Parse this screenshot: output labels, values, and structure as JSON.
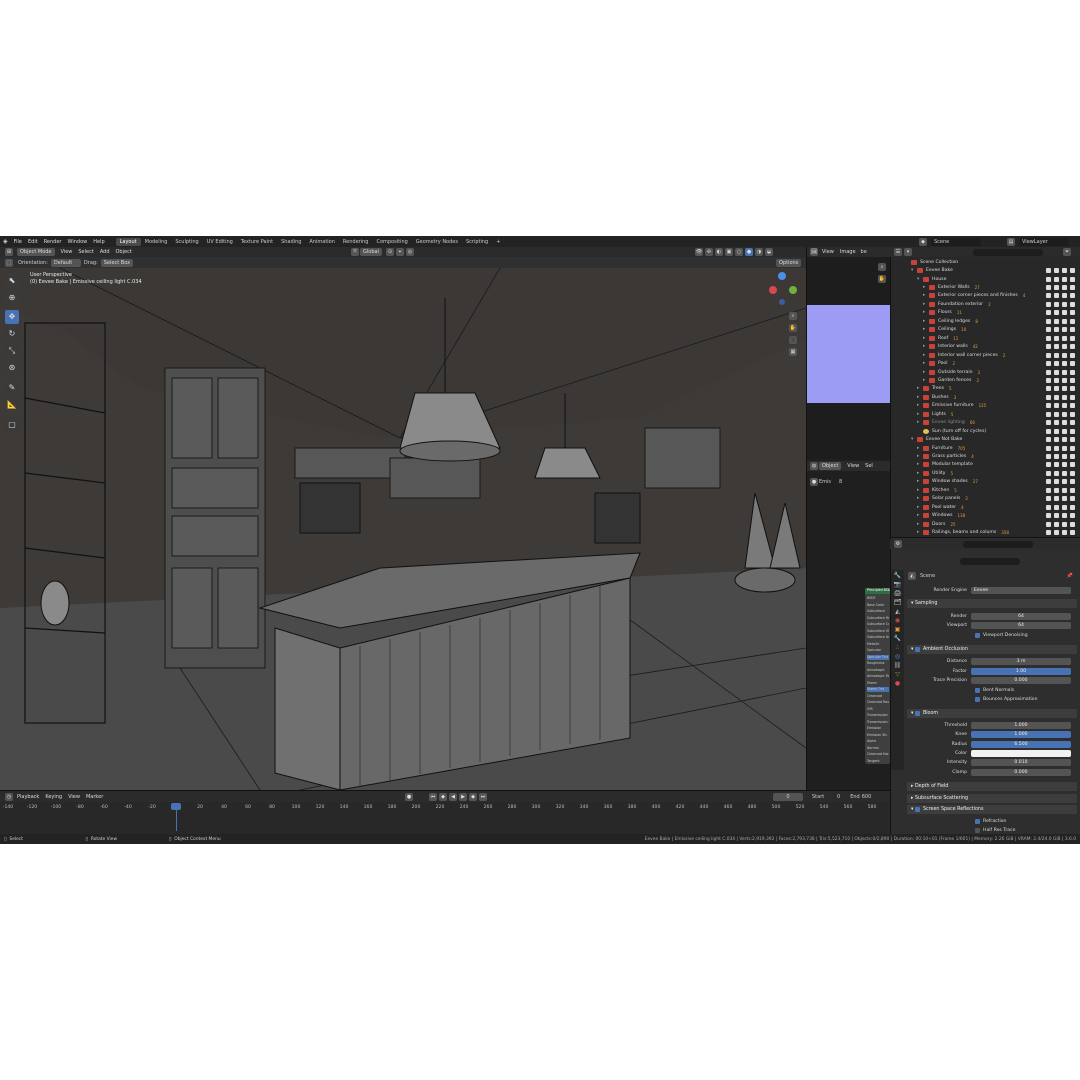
{
  "topbar": {
    "menus": [
      "File",
      "Edit",
      "Render",
      "Window",
      "Help"
    ],
    "workspaces": [
      "Layout",
      "Modeling",
      "Sculpting",
      "UV Editing",
      "Texture Paint",
      "Shading",
      "Animation",
      "Rendering",
      "Compositing",
      "Geometry Nodes",
      "Scripting",
      "+"
    ],
    "active_workspace": "Layout",
    "scene": "Scene",
    "view_layer": "ViewLayer"
  },
  "viewport_header": {
    "mode": "Object Mode",
    "menus": [
      "View",
      "Select",
      "Add",
      "Object"
    ],
    "transform": "Global",
    "orientation_label": "Orientation:",
    "orientation_value": "Default",
    "drag_label": "Drag:",
    "drag_value": "Select Box",
    "options": "Options"
  },
  "viewport": {
    "perspective": "User Perspective",
    "context": "(0) Eevee Bake | Emissive ceiling light C.034"
  },
  "image_editor": {
    "menus": [
      "View",
      "Image"
    ],
    "tab": "be"
  },
  "node_editor": {
    "mode": "Object",
    "menu": "View",
    "menu2": "Sel",
    "tab": "Emis",
    "count": "8",
    "node_title": "Principled BSDF",
    "node_rows": [
      "BSDF",
      "Base Color",
      "Subsurface",
      "Subsurface Rad.",
      "Subsurface Col.",
      "Subsurface IOR",
      "Subsurface Aniso",
      "Metallic",
      "Specular",
      "Specular Tint",
      "Roughness",
      "Anisotropic",
      "Anisotropic Rot.",
      "Sheen",
      "Sheen Tint",
      "Clearcoat",
      "Clearcoat Rough.",
      "IOR",
      "Transmission",
      "Transmission R.",
      "Emission",
      "Emission Str.",
      "Alpha",
      "Normal",
      "Clearcoat Normal",
      "Tangent"
    ]
  },
  "outliner": {
    "rows": [
      {
        "label": "Scene Collection",
        "indent": 0,
        "arrow": ""
      },
      {
        "label": "Eevee Bake",
        "indent": 1,
        "arrow": "▾"
      },
      {
        "label": "House",
        "indent": 2,
        "arrow": "▾"
      },
      {
        "label": "Exterior Walls",
        "indent": 3,
        "arrow": "▸",
        "badge": "27"
      },
      {
        "label": "Exterior corner pieces and finishes",
        "indent": 3,
        "arrow": "▸",
        "badge": "4"
      },
      {
        "label": "Foundation exterior",
        "indent": 3,
        "arrow": "▸",
        "badge": "2"
      },
      {
        "label": "Floors",
        "indent": 3,
        "arrow": "▸",
        "badge": "11"
      },
      {
        "label": "Ceiling ledges",
        "indent": 3,
        "arrow": "▸",
        "badge": "8"
      },
      {
        "label": "Ceilings",
        "indent": 3,
        "arrow": "▸",
        "badge": "10"
      },
      {
        "label": "Roof",
        "indent": 3,
        "arrow": "▸",
        "badge": "11"
      },
      {
        "label": "Interior walls",
        "indent": 3,
        "arrow": "▸",
        "badge": "42"
      },
      {
        "label": "Interior wall corner pieces",
        "indent": 3,
        "arrow": "▸",
        "badge": "2"
      },
      {
        "label": "Pool",
        "indent": 3,
        "arrow": "▸",
        "badge": "2"
      },
      {
        "label": "Outside terrain",
        "indent": 3,
        "arrow": "▸",
        "badge": "3"
      },
      {
        "label": "Garden fences",
        "indent": 3,
        "arrow": "▸",
        "badge": "3"
      },
      {
        "label": "Trees",
        "indent": 2,
        "arrow": "▸",
        "badge": "5"
      },
      {
        "label": "Bushes",
        "indent": 2,
        "arrow": "▸",
        "badge": "3"
      },
      {
        "label": "Emissive furniture",
        "indent": 2,
        "arrow": "▸",
        "badge": "125"
      },
      {
        "label": "Lights",
        "indent": 2,
        "arrow": "▸",
        "badge": "5"
      },
      {
        "label": "Eevee lighting",
        "indent": 2,
        "arrow": "▸",
        "badge": "66",
        "dim": true
      },
      {
        "label": "Sun (turn off for cycles)",
        "indent": 2,
        "arrow": "",
        "light": true
      },
      {
        "label": "Eevee Not Bake",
        "indent": 1,
        "arrow": "▾"
      },
      {
        "label": "Furniture",
        "indent": 2,
        "arrow": "▸",
        "badge": "705"
      },
      {
        "label": "Grass particles",
        "indent": 2,
        "arrow": "▸",
        "badge": "4"
      },
      {
        "label": "Modular template",
        "indent": 2,
        "arrow": "▸"
      },
      {
        "label": "Utility",
        "indent": 2,
        "arrow": "▸",
        "badge": "5"
      },
      {
        "label": "Window shades",
        "indent": 2,
        "arrow": "▸",
        "badge": "27"
      },
      {
        "label": "Kitchen",
        "indent": 2,
        "arrow": "▸",
        "badge": "5"
      },
      {
        "label": "Solar panels",
        "indent": 2,
        "arrow": "▸",
        "badge": "2"
      },
      {
        "label": "Pool water",
        "indent": 2,
        "arrow": "▸",
        "badge": "4"
      },
      {
        "label": "Windows",
        "indent": 2,
        "arrow": "▸",
        "badge": "138"
      },
      {
        "label": "Doors",
        "indent": 2,
        "arrow": "▸",
        "badge": "25"
      },
      {
        "label": "Railings, beams and colums",
        "indent": 2,
        "arrow": "▸",
        "badge": "358"
      }
    ]
  },
  "properties": {
    "scene_label": "Scene",
    "render_engine_label": "Render Engine",
    "render_engine": "Eevee",
    "sampling": {
      "title": "Sampling",
      "render_label": "Render",
      "render": "64",
      "viewport_label": "Viewport",
      "viewport": "64",
      "denoise": "Viewport Denoising"
    },
    "ao": {
      "title": "Ambient Occlusion",
      "distance_label": "Distance",
      "distance": "3 m",
      "factor_label": "Factor",
      "factor": "1.00",
      "precision_label": "Trace Precision",
      "precision": "0.000",
      "bent": "Bent Normals",
      "bounces": "Bounces Approximation"
    },
    "bloom": {
      "title": "Bloom",
      "threshold_label": "Threshold",
      "threshold": "1.000",
      "knee_label": "Knee",
      "knee": "1.000",
      "radius_label": "Radius",
      "radius": "6.500",
      "color_label": "Color",
      "intensity_label": "Intensity",
      "intensity": "0.010",
      "clamp_label": "Clamp",
      "clamp": "0.000"
    },
    "dof": "Depth of Field",
    "sss": "Subsurface Scattering",
    "ssr": {
      "title": "Screen Space Reflections",
      "refraction": "Refraction",
      "half_res": "Half Res Trace"
    }
  },
  "timeline": {
    "menus": [
      "Playback",
      "Keying",
      "View",
      "Marker"
    ],
    "current_frame": "0",
    "start_label": "Start",
    "start": "0",
    "end_label": "End",
    "end": "600",
    "ticks": [
      "-140",
      "-120",
      "-100",
      "-80",
      "-60",
      "-40",
      "-20",
      "0",
      "20",
      "40",
      "60",
      "80",
      "100",
      "120",
      "140",
      "160",
      "180",
      "200",
      "220",
      "240",
      "260",
      "280",
      "300",
      "320",
      "340",
      "360",
      "380",
      "400",
      "420",
      "440",
      "460",
      "480",
      "500",
      "520",
      "540",
      "560",
      "580"
    ]
  },
  "statusbar": {
    "select": "Select",
    "rotate": "Rotate View",
    "context_menu": "Object Context Menu",
    "info": "Eevee Bake | Emissive ceiling light C.034 | Verts:2,919,392 | Faces:2,793,738 | Tris:5,523,710 | Objects:0/2,890 | Duration: 00:10+01 (Frame 1/601) | Memory: 2.26 GiB | VRAM: 2.4/24.0 GiB | 3.6.0"
  },
  "colors": {
    "accent": "#4772b3",
    "collection": "#c8413b",
    "background": "#303030"
  }
}
